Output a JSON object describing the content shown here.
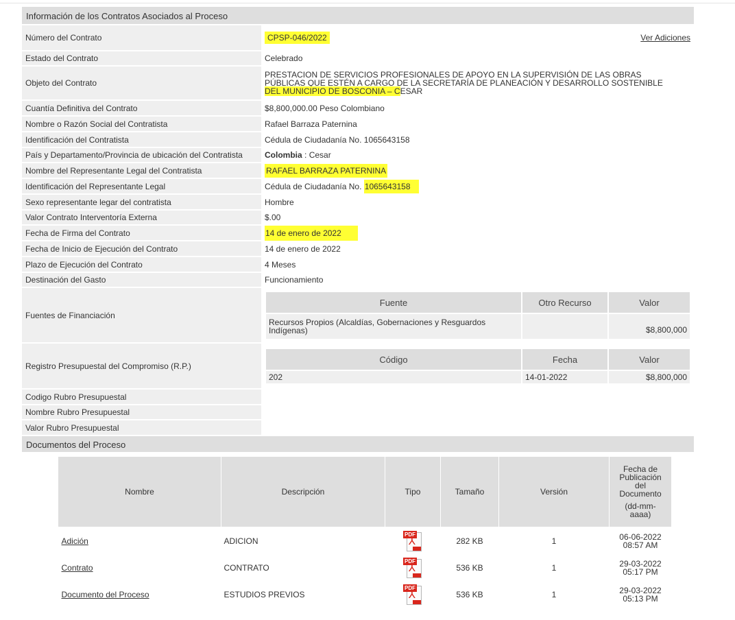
{
  "section_contracts": "Información de los Contratos Asociados al Proceso",
  "contract": {
    "numero": {
      "label": "Número del Contrato",
      "value": "CPSP-046/2022",
      "link": "Ver Adiciones"
    },
    "estado": {
      "label": "Estado del Contrato",
      "value": "Celebrado"
    },
    "objeto": {
      "label": "Objeto del Contrato",
      "line1": "PRESTACION DE SERVICIOS PROFESIONALES DE APOYO EN LA SUPERVISIÓN DE LAS OBRAS",
      "line2": "PÚBLICAS QUE ESTÉN A CARGO DE LA SECRETARÍA DE PLANEACIÓN Y DESARROLLO SOSTENIBLE",
      "line3_hl": "DEL MUNICIPIO DE BOSCONIA – C",
      "line3_rest": "ESAR"
    },
    "cuantia": {
      "label": "Cuantía Definitiva del Contrato",
      "value": "$8,800,000.00 Peso Colombiano"
    },
    "nombre": {
      "label": "Nombre o Razón Social del Contratista",
      "value": "Rafael Barraza Paternina"
    },
    "identificacion": {
      "label": "Identificación del Contratista",
      "value": "Cédula de Ciudadanía No. 1065643158"
    },
    "pais": {
      "label": "País y Departamento/Provincia de ubicación del Contratista",
      "country": "Colombia",
      "sep": " : ",
      "dept": "Cesar"
    },
    "rep_nombre": {
      "label": "Nombre del Representante Legal del Contratista",
      "value": "RAFAEL BARRAZA PATERNINA"
    },
    "rep_id": {
      "label": "Identificación del Representante Legal",
      "prefix": "Cédula de Ciudadanía No. ",
      "number": "1065643158"
    },
    "sexo": {
      "label": "Sexo representante legar del contratista",
      "value": "Hombre"
    },
    "interventoria": {
      "label": "Valor Contrato Interventoría Externa",
      "value": "$.00"
    },
    "fecha_firma": {
      "label": "Fecha de Firma del Contrato",
      "value": "14 de enero de 2022"
    },
    "fecha_inicio": {
      "label": "Fecha de Inicio de Ejecución del Contrato",
      "value": "14 de enero de 2022"
    },
    "plazo": {
      "label": "Plazo de Ejecución del Contrato",
      "value": "4 Meses"
    },
    "destinacion": {
      "label": "Destinación del Gasto",
      "value": "Funcionamiento"
    },
    "fuentes": {
      "label": "Fuentes de Financiación",
      "headers": [
        "Fuente",
        "Otro Recurso",
        "Valor"
      ],
      "row": {
        "fuente": "Recursos Propios (Alcaldías, Gobernaciones y Resguardos Indígenas)",
        "otro": "",
        "valor": "$8,800,000"
      }
    },
    "rp": {
      "label": "Registro Presupuestal del Compromiso (R.P.)",
      "headers": [
        "Código",
        "Fecha",
        "Valor"
      ],
      "row": {
        "codigo": "202",
        "fecha": "14-01-2022",
        "valor": "$8,800,000"
      }
    },
    "codigo_rubro": {
      "label": "Codigo Rubro Presupuestal"
    },
    "nombre_rubro": {
      "label": "Nombre Rubro Presupuestal"
    },
    "valor_rubro": {
      "label": "Valor Rubro Presupuestal"
    }
  },
  "section_docs": "Documentos del Proceso",
  "docs": {
    "headers": {
      "nombre": "Nombre",
      "descripcion": "Descripción",
      "tipo": "Tipo",
      "tamano": "Tamaño",
      "version": "Versión",
      "fecha_l1": "Fecha de",
      "fecha_l2": "Publicación",
      "fecha_l3": "del",
      "fecha_l4": "Documento",
      "fecha_l5": "(dd-mm-",
      "fecha_l6": "aaaa)"
    },
    "pdf_tag": "PDF",
    "rows": [
      {
        "nombre": "Adición",
        "descripcion": "ADICION",
        "tamano": "282 KB",
        "version": "1",
        "fecha": "06-06-2022",
        "hora": "08:57 AM"
      },
      {
        "nombre": "Contrato",
        "descripcion": "CONTRATO",
        "tamano": "536 KB",
        "version": "1",
        "fecha": "29-03-2022",
        "hora": "05:17 PM"
      },
      {
        "nombre": "Documento del Proceso",
        "descripcion": "ESTUDIOS PREVIOS",
        "tamano": "536 KB",
        "version": "1",
        "fecha": "29-03-2022",
        "hora": "05:13 PM"
      }
    ]
  }
}
